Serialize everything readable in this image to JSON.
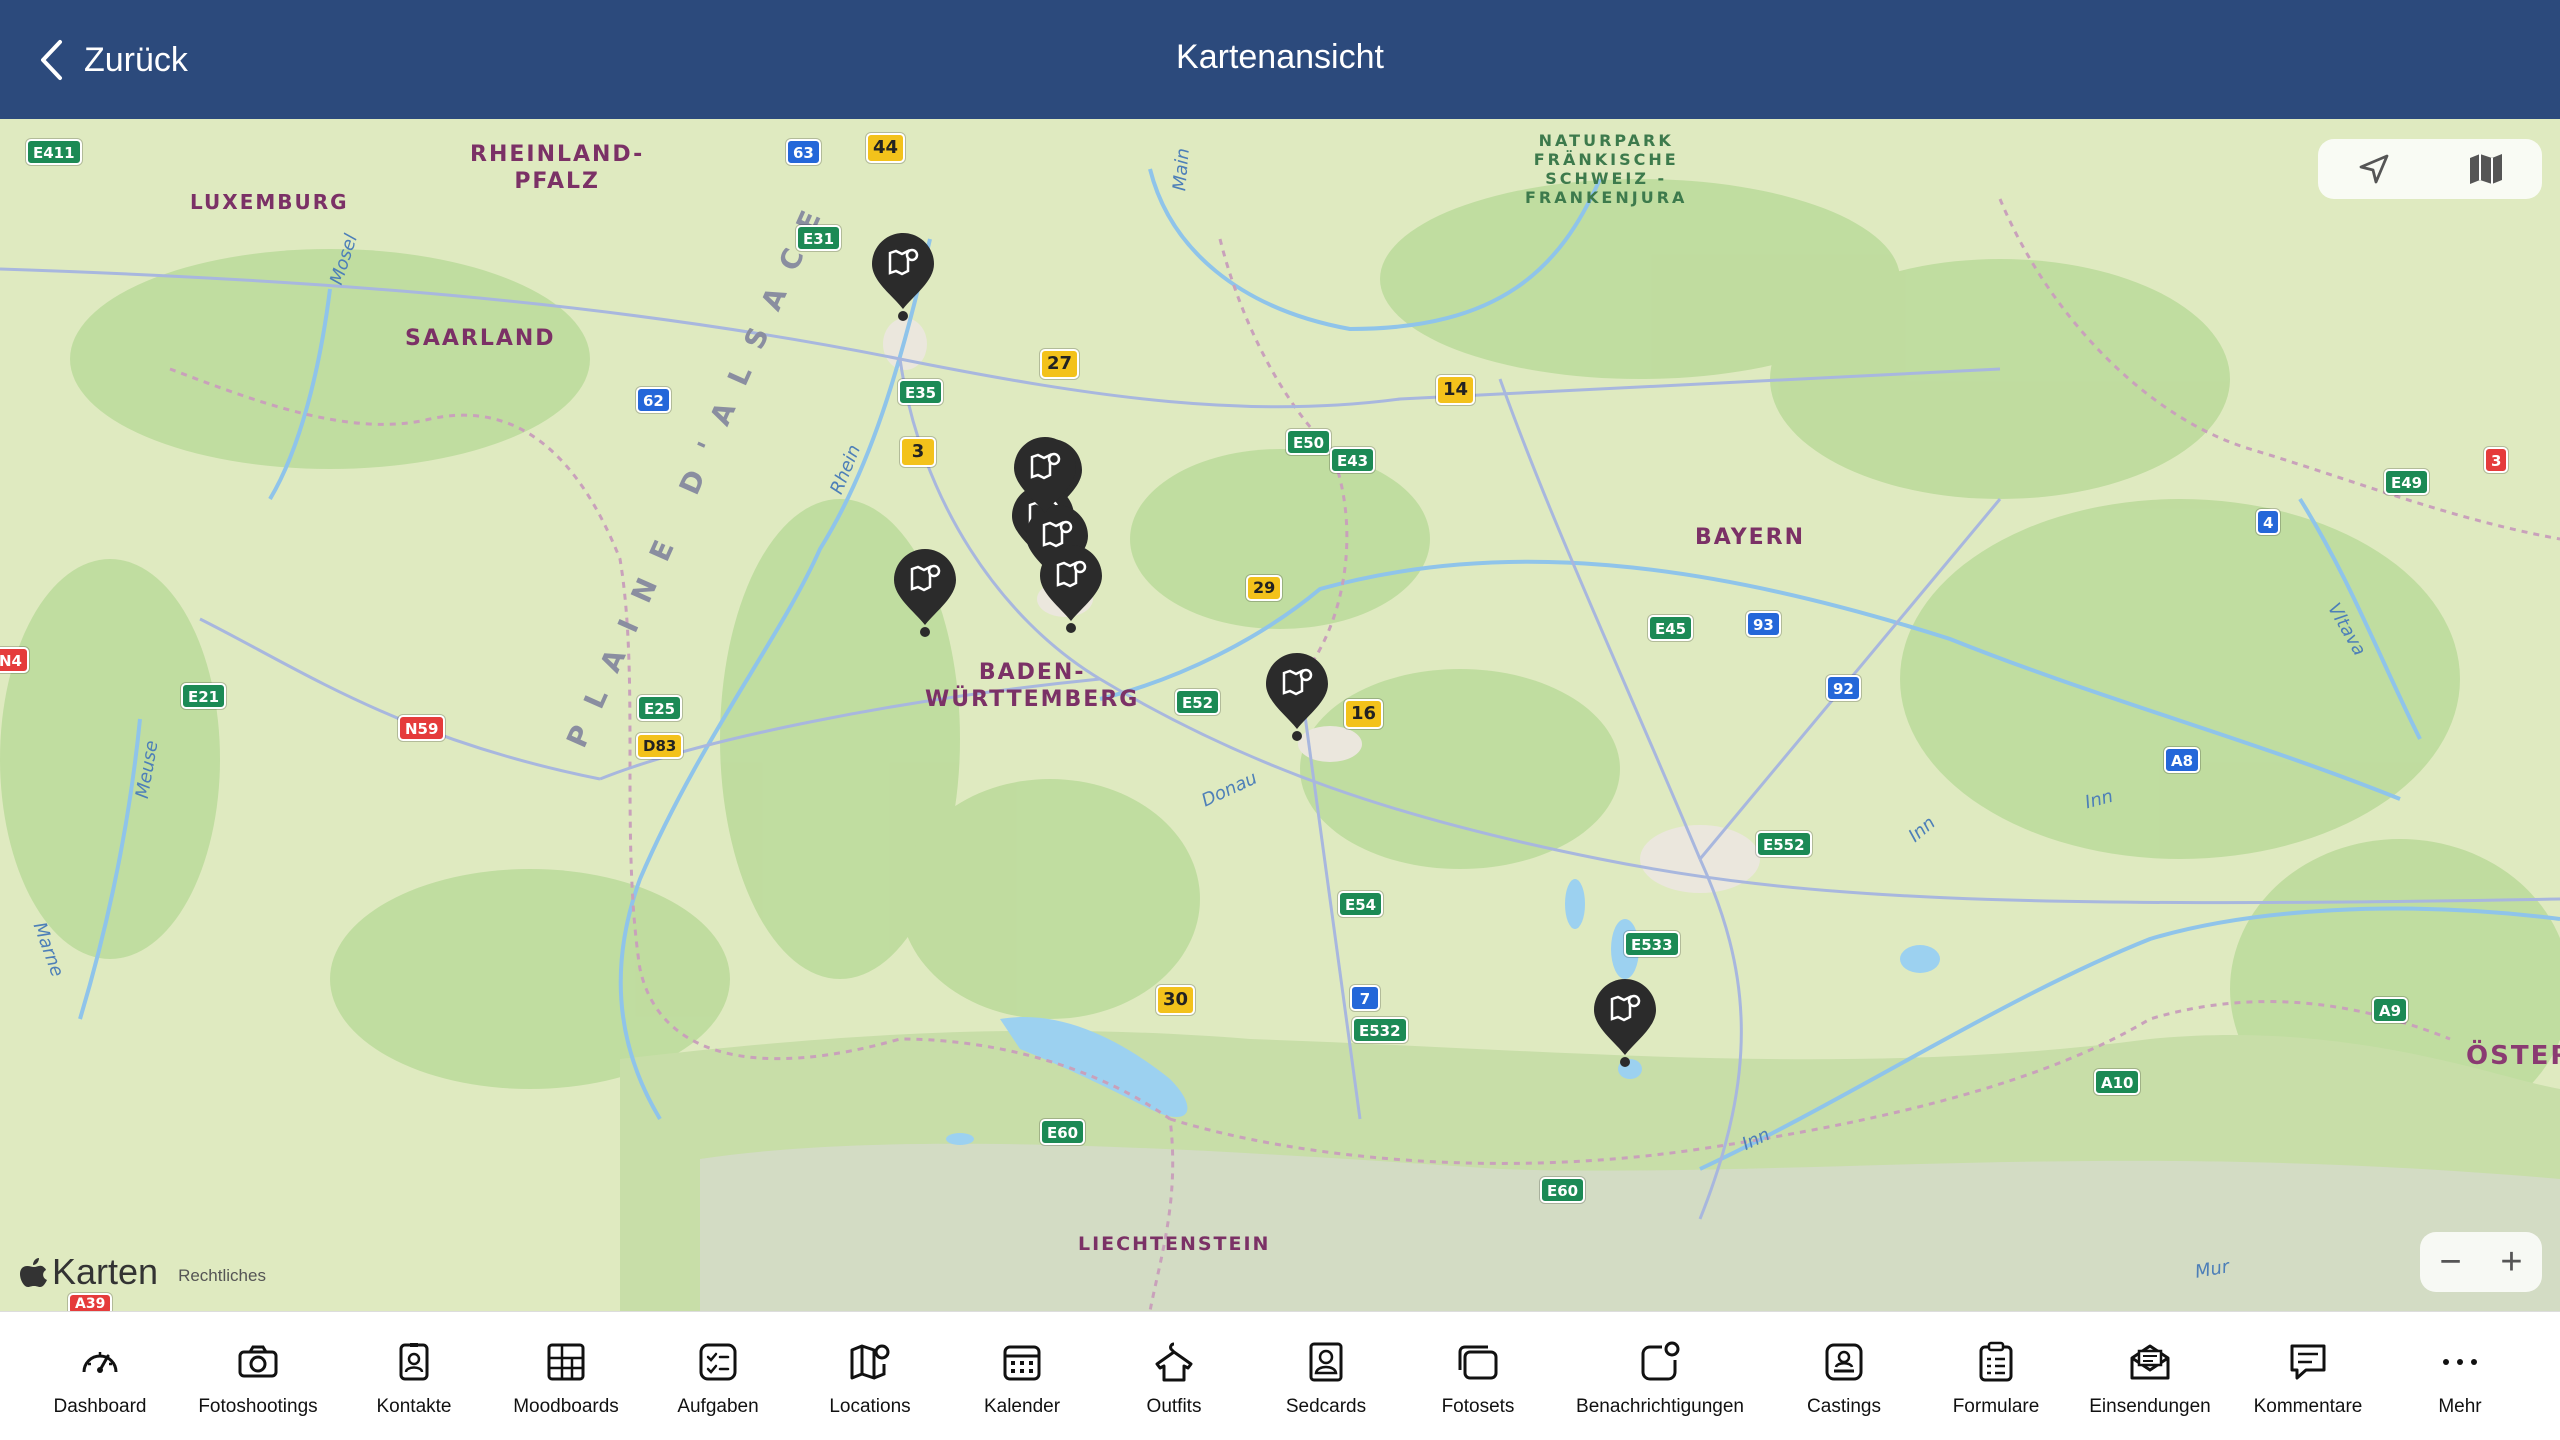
{
  "header": {
    "back_label": "Zurück",
    "title": "Kartenansicht"
  },
  "map": {
    "region_labels": [
      "RHEINLAND-\nPFALZ",
      "LUXEMBURG",
      "SAARLAND",
      "BADEN-\nWÜRTTEMBERG",
      "BAYERN",
      "LIECHTENSTEIN",
      "ÖSTER"
    ],
    "park_label": "NATURPARK\nFRÄNKISCHE\nSCHWEIZ -\nFRANKENJURA",
    "area_label": "PLAINE D'ALSACE",
    "rivers": [
      "Mosel",
      "Main",
      "Rhein",
      "Meuse",
      "Marne",
      "Donau",
      "Inn",
      "Inn",
      "Inn",
      "Vltava",
      "Mur"
    ],
    "shields": [
      "E411",
      "63",
      "44",
      "E31",
      "27",
      "14",
      "E35",
      "62",
      "3",
      "E50",
      "E43",
      "29",
      "E52",
      "16",
      "E25",
      "D83",
      "E21",
      "N59",
      "N4",
      "E49",
      "3",
      "4",
      "E45",
      "93",
      "92",
      "A8",
      "E552",
      "E54",
      "E533",
      "30",
      "7",
      "E532",
      "A9",
      "A10",
      "E60",
      "E60",
      "A39"
    ],
    "attribution": "Karten",
    "legal": "Rechtliches",
    "zoom_out": "−",
    "zoom_in": "+"
  },
  "tabs": [
    {
      "label": "Dashboard",
      "icon": "dashboard-icon"
    },
    {
      "label": "Fotoshootings",
      "icon": "camera-icon"
    },
    {
      "label": "Kontakte",
      "icon": "contacts-icon"
    },
    {
      "label": "Moodboards",
      "icon": "moodboard-icon"
    },
    {
      "label": "Aufgaben",
      "icon": "tasks-icon"
    },
    {
      "label": "Locations",
      "icon": "map-pin-icon"
    },
    {
      "label": "Kalender",
      "icon": "calendar-icon"
    },
    {
      "label": "Outfits",
      "icon": "outfit-icon"
    },
    {
      "label": "Sedcards",
      "icon": "sedcard-icon"
    },
    {
      "label": "Fotosets",
      "icon": "photoset-icon"
    },
    {
      "label": "Benachrichtigungen",
      "icon": "notification-icon"
    },
    {
      "label": "Castings",
      "icon": "casting-icon"
    },
    {
      "label": "Formulare",
      "icon": "form-icon"
    },
    {
      "label": "Einsendungen",
      "icon": "submission-icon"
    },
    {
      "label": "Kommentare",
      "icon": "comment-icon"
    },
    {
      "label": "Mehr",
      "icon": "more-icon"
    }
  ],
  "colors": {
    "header": "#2c4a7c",
    "map_land": "#dfeac0",
    "forest": "#b9d898",
    "water": "#9cd1f0",
    "pin": "#2b2b2b"
  }
}
